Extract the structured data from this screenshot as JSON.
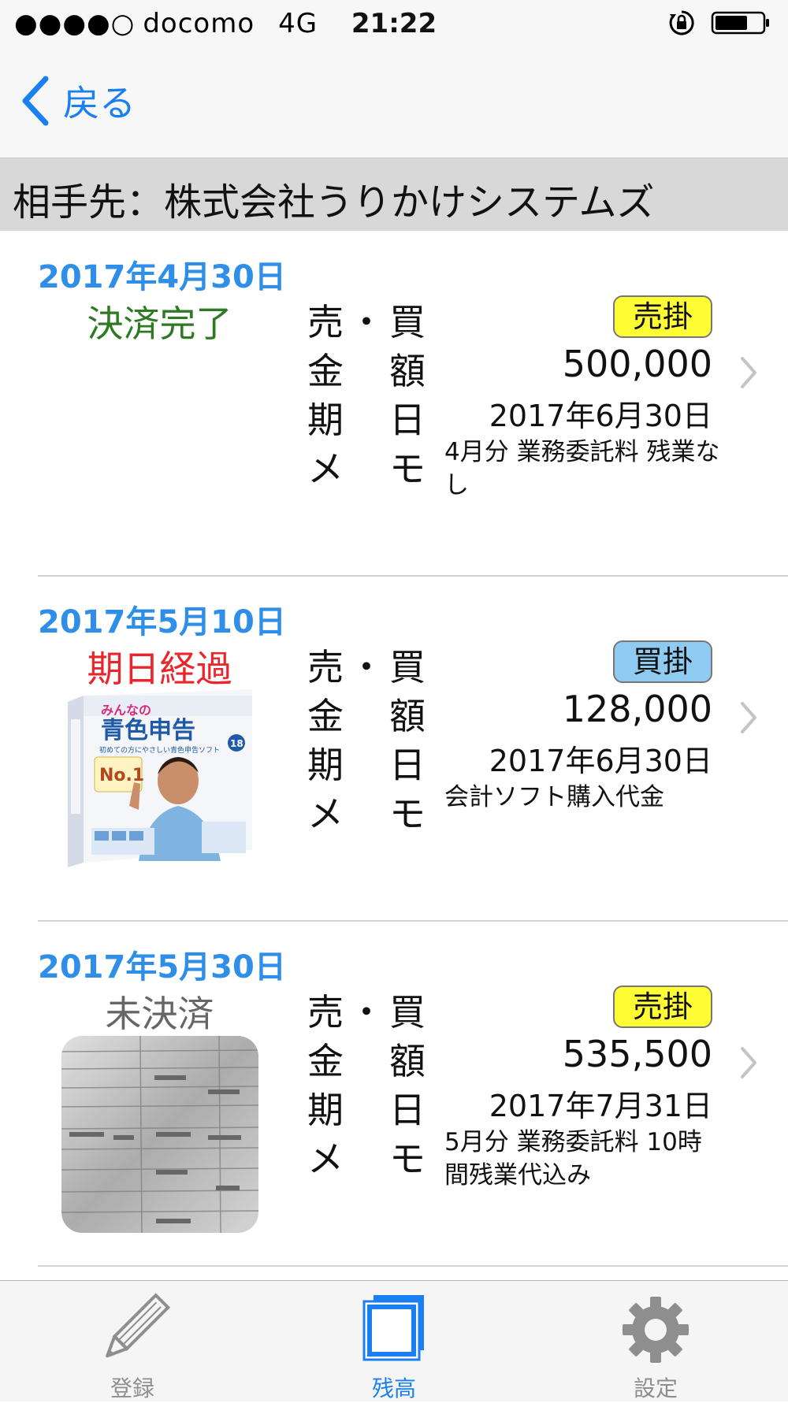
{
  "status_bar": {
    "signal": "●●●●○",
    "carrier": "docomo",
    "network": "4G",
    "time": "21:22"
  },
  "nav": {
    "back_label": "戻る"
  },
  "partner": {
    "label": "相手先：株式会社うりかけシステムズ"
  },
  "field_labels": {
    "type": [
      "売",
      "・",
      "買"
    ],
    "amount": [
      "金",
      "額"
    ],
    "due": [
      "期",
      "日"
    ],
    "memo": [
      "メ",
      "モ"
    ]
  },
  "rows": [
    {
      "date": "2017年4月30日",
      "status": "決済完了",
      "badge": "売掛",
      "amount": "500,000",
      "due": "2017年6月30日",
      "memo": "4月分 業務委託料 残業なし"
    },
    {
      "date": "2017年5月10日",
      "status": "期日経過",
      "badge": "買掛",
      "amount": "128,000",
      "due": "2017年6月30日",
      "memo": "会計ソフト購入代金",
      "thumb_text": {
        "brand": "みんなの",
        "title": "青色申告",
        "subtitle": "初めての方にやさしい青色申告ソフト",
        "rank": "No.1",
        "version": "18"
      }
    },
    {
      "date": "2017年5月30日",
      "status": "未決済",
      "badge": "売掛",
      "amount": "535,500",
      "due": "2017年7月31日",
      "memo": "5月分 業務委託料 10時間残業代込み"
    }
  ],
  "tabs": [
    {
      "label": "登録"
    },
    {
      "label": "残高"
    },
    {
      "label": "設定"
    }
  ],
  "colors": {
    "accent": "#1a7ff0",
    "date": "#2f8fe8",
    "paid": "#2c7a22",
    "overdue": "#e8262b",
    "unpaid": "#666666",
    "badge_sell": "#fffd33",
    "badge_buy": "#8fcaf0"
  }
}
